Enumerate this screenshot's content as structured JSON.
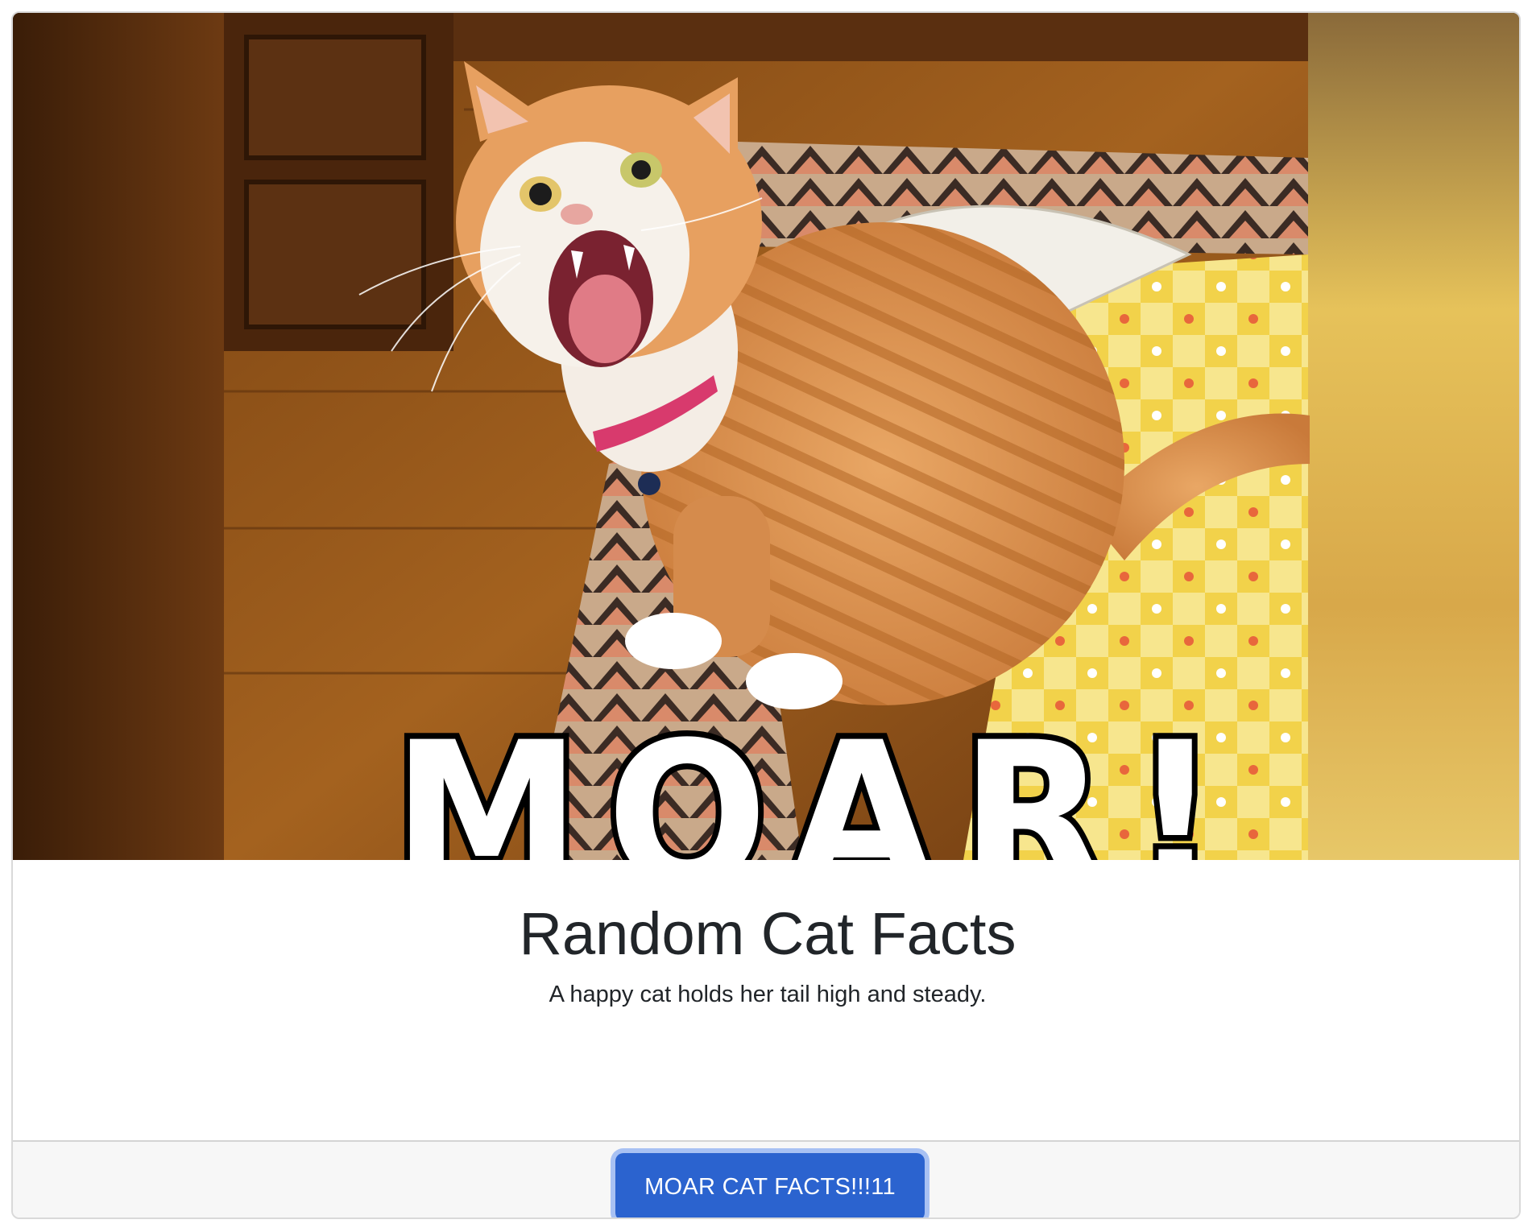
{
  "card": {
    "image": {
      "alt_icon": "cat-meme-image",
      "caption_overlay": "MOAR!"
    },
    "title": "Random Cat Facts",
    "fact": "A happy cat holds her tail high and steady.",
    "button_label": "MOAR CAT FACTS!!!11"
  },
  "colors": {
    "button_bg": "#2b63cf",
    "button_focus_ring": "#a8c1f3",
    "text": "#212529",
    "footer_bg": "#f7f7f7"
  }
}
